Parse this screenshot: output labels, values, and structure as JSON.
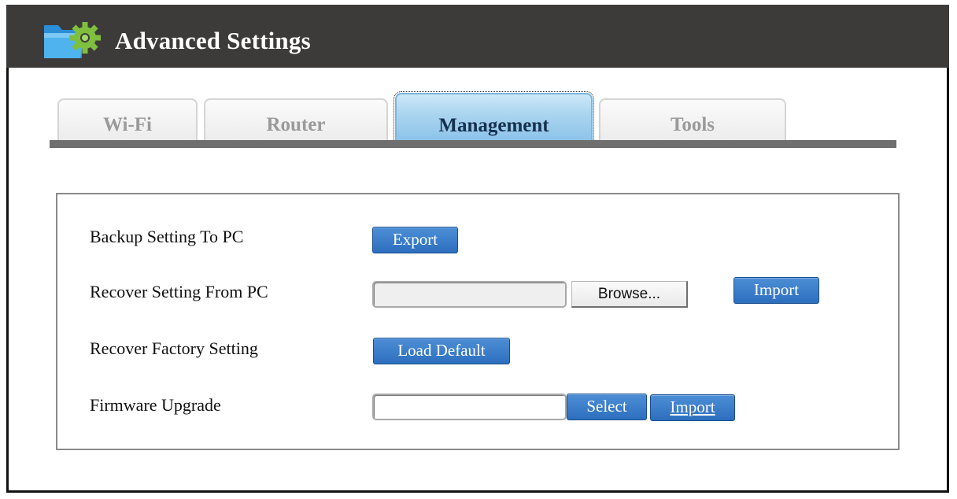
{
  "header": {
    "title": "Advanced Settings",
    "logo_icon": "folder-gear-icon"
  },
  "tabs": [
    {
      "label": "Wi-Fi",
      "active": false
    },
    {
      "label": "Router",
      "active": false
    },
    {
      "label": "Management",
      "active": true
    },
    {
      "label": "Tools",
      "active": false
    }
  ],
  "management": {
    "backup": {
      "label": "Backup Setting To PC",
      "button": "Export"
    },
    "recover": {
      "label": "Recover Setting From PC",
      "file_value": "",
      "browse_button": "Browse...",
      "import_button": "Import"
    },
    "factory": {
      "label": "Recover Factory Setting",
      "button": "Load Default"
    },
    "firmware": {
      "label": "Firmware Upgrade",
      "file_value": "",
      "select_button": "Select",
      "import_button": "Import"
    }
  },
  "colors": {
    "header_bg": "#3d3b3a",
    "active_tab": "#a9d4ef",
    "button_blue": "#2d6fbe",
    "tab_bar": "#6f6f6f"
  }
}
